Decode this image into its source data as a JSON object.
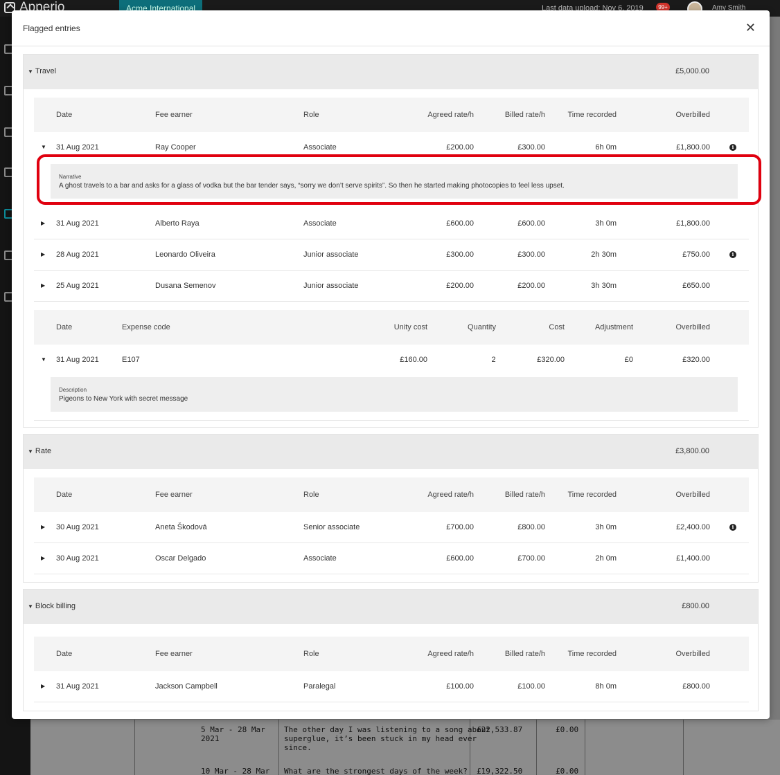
{
  "app": {
    "logo": "Apperio",
    "org": "Acme International",
    "last_upload": "Last data upload: Nov 6, 2019",
    "notifications": "99+",
    "user": "Amy Smith"
  },
  "background_rows": [
    {
      "period": "5 Mar - 28 Mar\n2021",
      "narrative": "The other day I was listening to a song about\nsuperglue, it’s been stuck in my head ever\nsince.",
      "amount": "£22,533.87",
      "adj": "£0.00"
    },
    {
      "period": "10 Mar - 28 Mar",
      "narrative": "What are the strongest days of the week?",
      "amount": "£19,322.50",
      "adj": "£0.00"
    }
  ],
  "modal": {
    "title": "Flagged entries",
    "close": "✕"
  },
  "headers": {
    "date": "Date",
    "fee_earner": "Fee earner",
    "role": "Role",
    "agreed": "Agreed rate/h",
    "billed": "Billed rate/h",
    "time": "Time recorded",
    "overbilled": "Overbilled",
    "expense_code": "Expense code",
    "unity_cost": "Unity cost",
    "quantity": "Quantity",
    "cost": "Cost",
    "adjustment": "Adjustment"
  },
  "sections": [
    {
      "title": "Travel",
      "total": "£5,000.00",
      "rows": [
        {
          "date": "31 Aug 2021",
          "fee_earner": "Ray Cooper",
          "role": "Associate",
          "agreed": "£200.00",
          "billed": "£300.00",
          "time": "6h 0m",
          "overbilled": "£1,800.00",
          "expanded": true
        },
        {
          "date": "31 Aug 2021",
          "fee_earner": "Alberto Raya",
          "role": "Associate",
          "agreed": "£600.00",
          "billed": "£600.00",
          "time": "3h 0m",
          "overbilled": "£1,800.00"
        },
        {
          "date": "28 Aug 2021",
          "fee_earner": "Leonardo Oliveira",
          "role": "Junior associate",
          "agreed": "£300.00",
          "billed": "£300.00",
          "time": "2h 30m",
          "overbilled": "£750.00"
        },
        {
          "date": "25 Aug 2021",
          "fee_earner": "Dusana Semenov",
          "role": "Junior associate",
          "agreed": "£200.00",
          "billed": "£200.00",
          "time": "3h 30m",
          "overbilled": "£650.00"
        }
      ],
      "narrative_label": "Narrative",
      "narrative": "A ghost travels to a bar and asks for a glass of vodka but the bar tender says, “sorry we don’t serve spirits”. So then he started making photocopies to feel less upset.",
      "expenses": [
        {
          "date": "31 Aug 2021",
          "code": "E107",
          "unity_cost": "£160.00",
          "quantity": "2",
          "cost": "£320.00",
          "adjustment": "£0",
          "overbilled": "£320.00"
        }
      ],
      "description_label": "Description",
      "description": "Pigeons to New York with secret message"
    },
    {
      "title": "Rate",
      "total": "£3,800.00",
      "rows": [
        {
          "date": "30 Aug 2021",
          "fee_earner": "Aneta Škodová",
          "role": "Senior associate",
          "agreed": "£700.00",
          "billed": "£800.00",
          "time": "3h 0m",
          "overbilled": "£2,400.00"
        },
        {
          "date": "30 Aug 2021",
          "fee_earner": "Oscar Delgado",
          "role": "Associate",
          "agreed": "£600.00",
          "billed": "£700.00",
          "time": "2h 0m",
          "overbilled": "£1,400.00"
        }
      ]
    },
    {
      "title": "Block billing",
      "total": "£800.00",
      "rows": [
        {
          "date": "31 Aug 2021",
          "fee_earner": "Jackson Campbell",
          "role": "Paralegal",
          "agreed": "£100.00",
          "billed": "£100.00",
          "time": "8h 0m",
          "overbilled": "£800.00"
        }
      ]
    }
  ]
}
